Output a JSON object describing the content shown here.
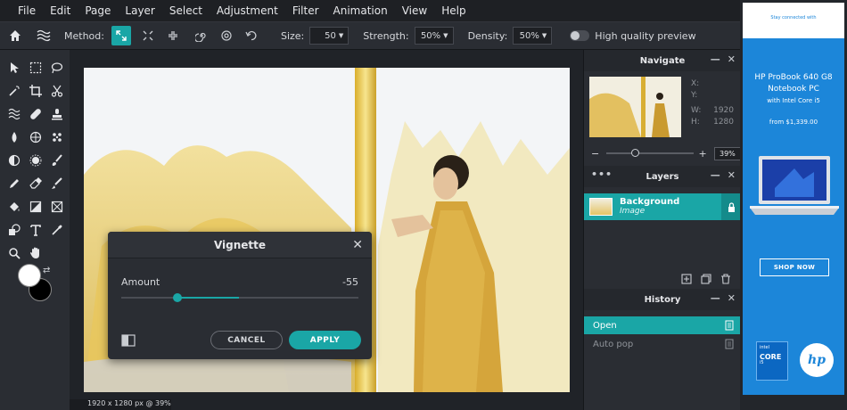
{
  "menu": [
    "File",
    "Edit",
    "Page",
    "Layer",
    "Select",
    "Adjustment",
    "Filter",
    "Animation",
    "View",
    "Help"
  ],
  "toolbar": {
    "method_label": "Method:",
    "size_label": "Size:",
    "size_value": "50",
    "strength_label": "Strength:",
    "strength_value": "50%",
    "density_label": "Density:",
    "density_value": "50%",
    "hq_label": "High quality preview",
    "hq_enabled": false
  },
  "colors": {
    "foreground": "#ffffff",
    "background": "#000000",
    "accent": "#1aa6a6"
  },
  "dialog": {
    "title": "Vignette",
    "amount_label": "Amount",
    "amount_value": "-55",
    "cancel_label": "CANCEL",
    "apply_label": "APPLY"
  },
  "canvas": {
    "status": "1920 x 1280 px @ 39%"
  },
  "navigate": {
    "title": "Navigate",
    "x_label": "X:",
    "y_label": "Y:",
    "w_label": "W:",
    "w_value": "1920",
    "h_label": "H:",
    "h_value": "1280",
    "zoom": "39%"
  },
  "layers": {
    "title": "Layers",
    "items": [
      {
        "name": "Background",
        "type": "Image",
        "locked": true
      }
    ]
  },
  "history": {
    "title": "History",
    "items": [
      {
        "label": "Open",
        "active": true
      },
      {
        "label": "Auto pop",
        "active": false
      }
    ]
  },
  "ad": {
    "tagline": "Stay connected with",
    "product_line1": "HP ProBook 640 G8",
    "product_line2": "Notebook PC",
    "product_line3": "with Intel Core i5",
    "price": "from $1,339.00",
    "cta": "SHOP NOW",
    "intel_text": "intel",
    "intel_big": "CORE",
    "intel_tier": "i5",
    "hp_logo": "hp"
  }
}
